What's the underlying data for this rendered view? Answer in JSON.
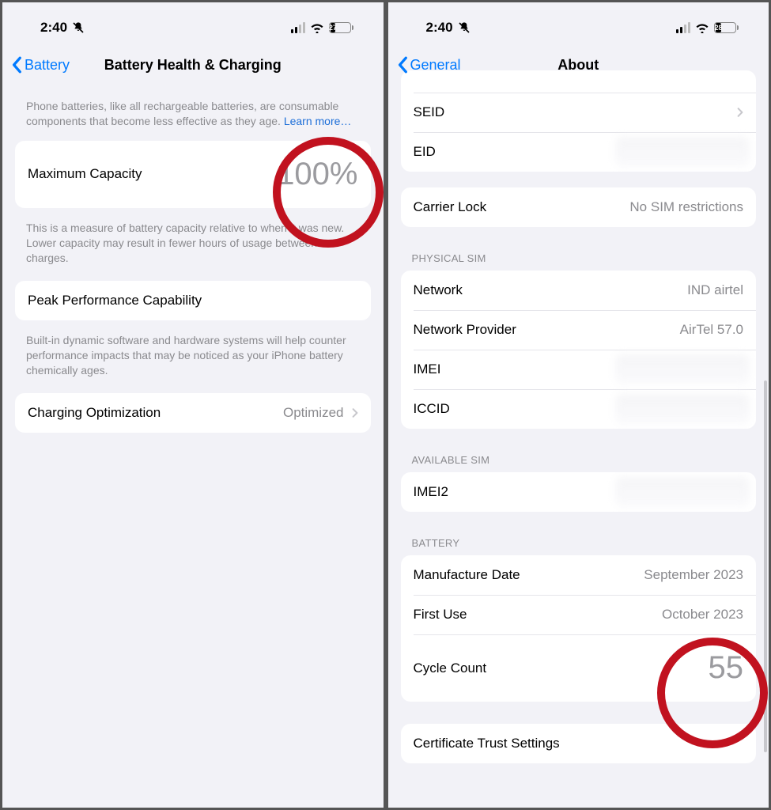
{
  "left": {
    "status": {
      "time": "2:40",
      "battery_pct_text": "27",
      "battery_fill_pct": 28
    },
    "nav": {
      "back": "Battery",
      "title": "Battery Health & Charging"
    },
    "intro_text": "Phone batteries, like all rechargeable batteries, are consumable components that become less effective as they age. ",
    "intro_link": "Learn more…",
    "max_capacity": {
      "label": "Maximum Capacity",
      "value": "100%"
    },
    "max_capacity_foot": "This is a measure of battery capacity relative to when it was new. Lower capacity may result in fewer hours of usage between charges.",
    "peak": {
      "label": "Peak Performance Capability"
    },
    "peak_foot": "Built-in dynamic software and hardware systems will help counter performance impacts that may be noticed as your iPhone battery chemically ages.",
    "charging_opt": {
      "label": "Charging Optimization",
      "value": "Optimized"
    }
  },
  "right": {
    "status": {
      "time": "2:40",
      "battery_pct_text": "28",
      "battery_fill_pct": 29
    },
    "nav": {
      "back": "General",
      "title": "About"
    },
    "top_rows": {
      "seid": "SEID",
      "eid": "EID"
    },
    "carrier_lock": {
      "label": "Carrier Lock",
      "value": "No SIM restrictions"
    },
    "physical_sim_header": "PHYSICAL SIM",
    "physical_sim": {
      "network": {
        "label": "Network",
        "value": "IND airtel"
      },
      "network_provider": {
        "label": "Network Provider",
        "value": "AirTel 57.0"
      },
      "imei": {
        "label": "IMEI"
      },
      "iccid": {
        "label": "ICCID"
      }
    },
    "available_sim_header": "AVAILABLE SIM",
    "available_sim": {
      "imei2": {
        "label": "IMEI2"
      }
    },
    "battery_header": "BATTERY",
    "battery": {
      "manufacture": {
        "label": "Manufacture Date",
        "value": "September 2023"
      },
      "first_use": {
        "label": "First Use",
        "value": "October 2023"
      },
      "cycle_count": {
        "label": "Cycle Count",
        "value": "55"
      }
    },
    "cert": {
      "label": "Certificate Trust Settings"
    }
  }
}
